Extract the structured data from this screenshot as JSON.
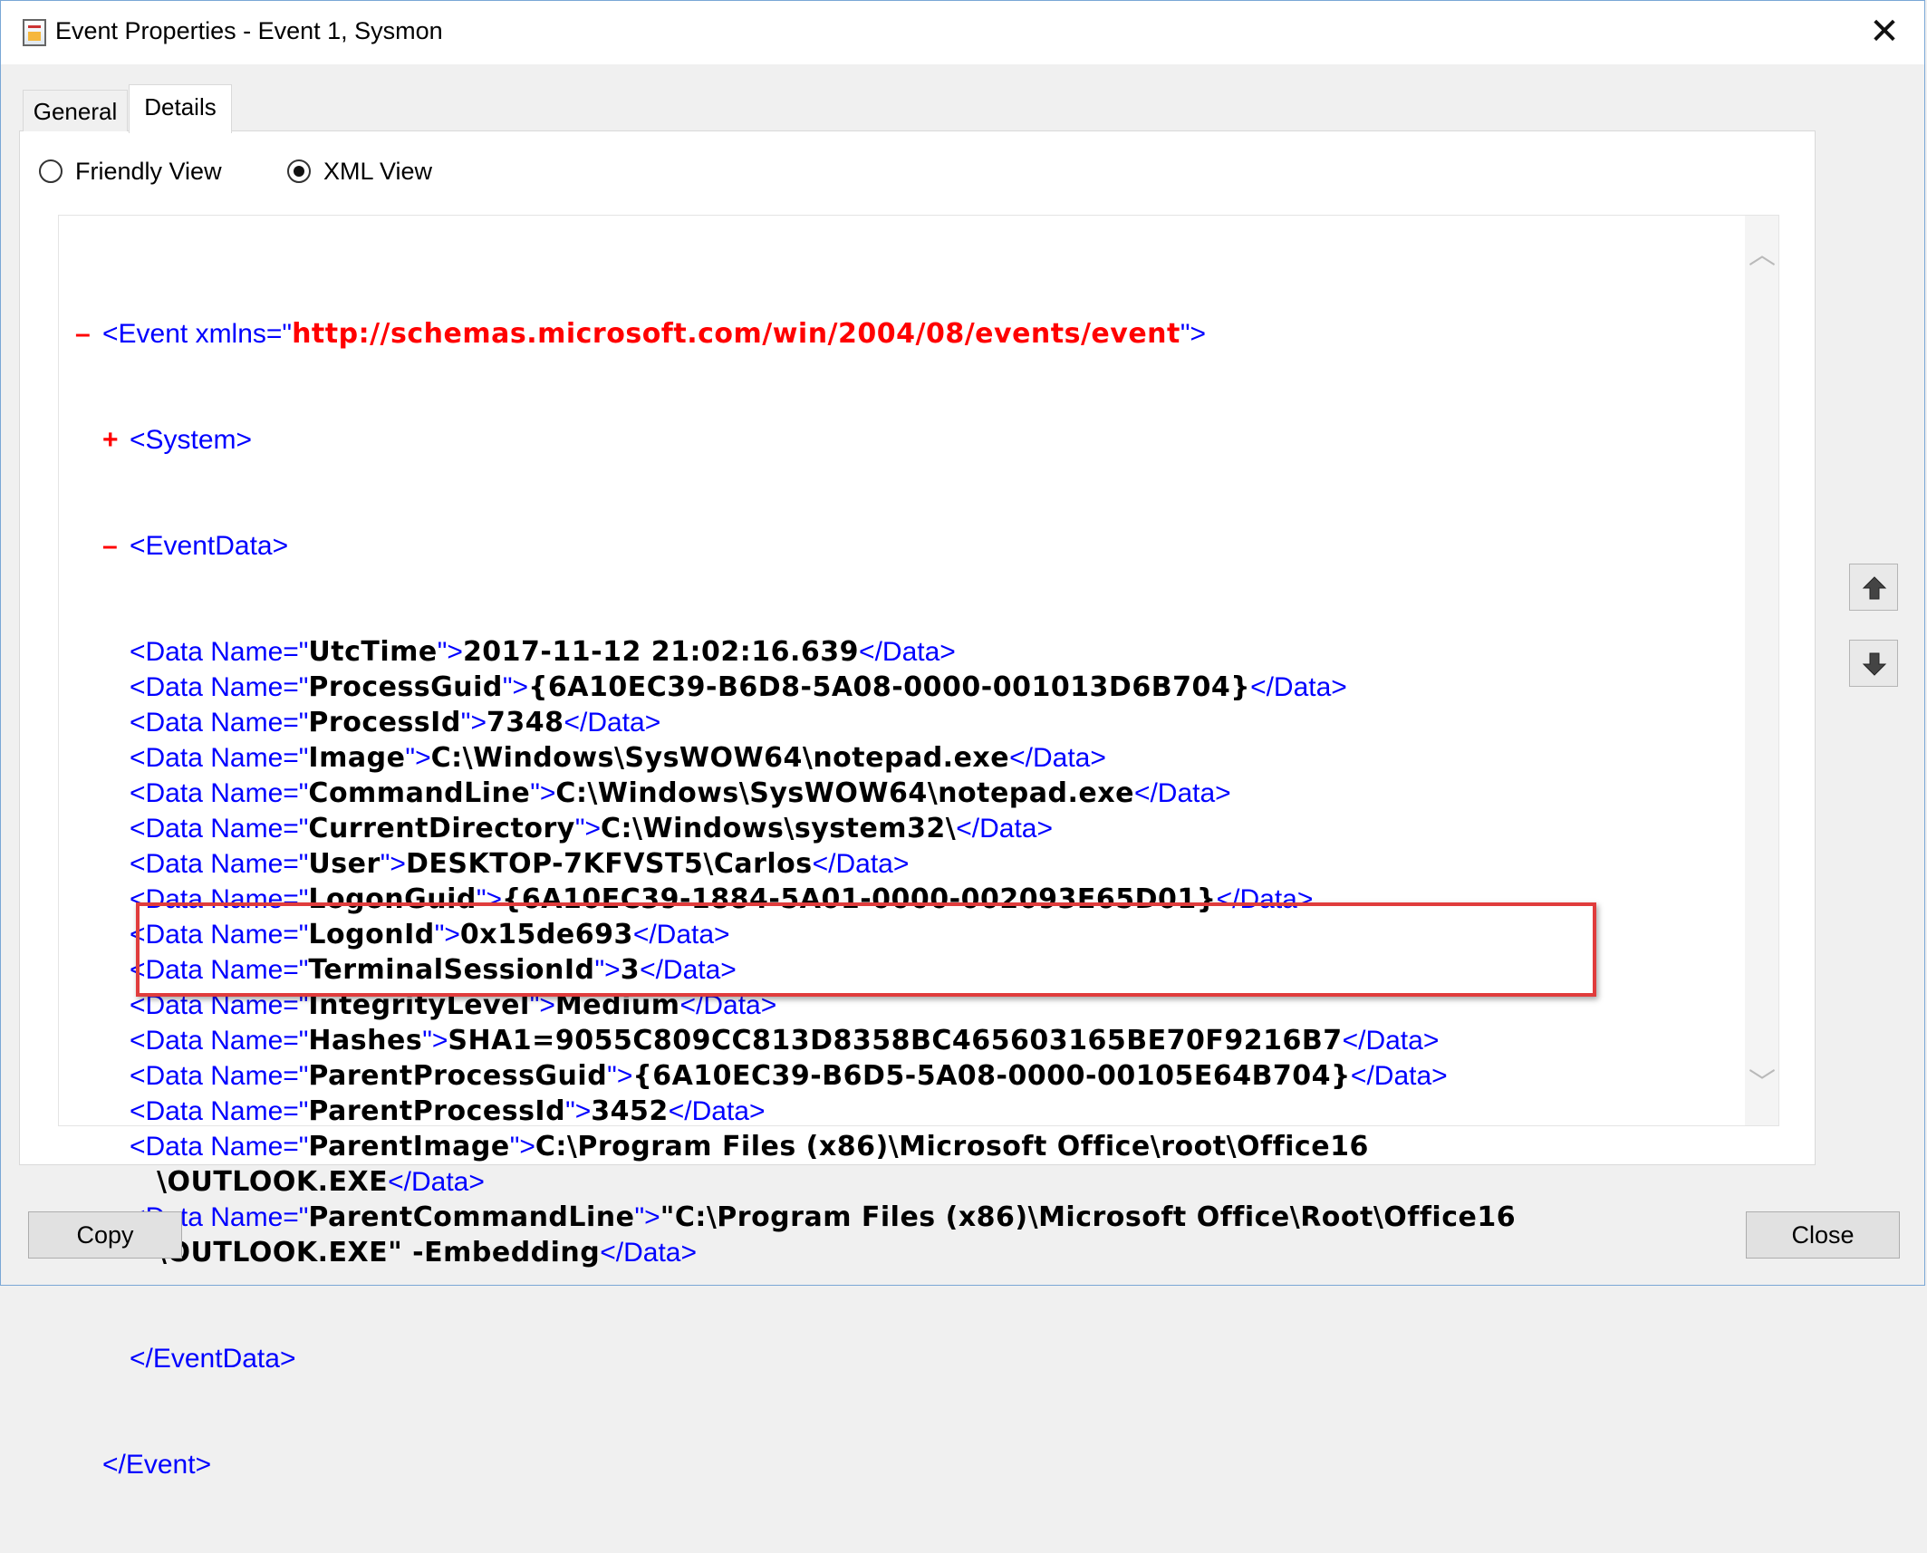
{
  "window": {
    "title": "Event Properties - Event 1, Sysmon",
    "close_glyph": "✕"
  },
  "tabs": [
    {
      "label": "General",
      "selected": false
    },
    {
      "label": "Details",
      "selected": true
    }
  ],
  "view_options": {
    "friendly_label": "Friendly View",
    "xml_label": "XML View",
    "selected": "XML View"
  },
  "xml": {
    "event_open_prefix": "<Event xmlns=\"",
    "event_ns": "http://schemas.microsoft.com/win/2004/08/events/event",
    "event_open_suffix": "\">",
    "expand_sign": "+",
    "collapse_sign": "–",
    "system_tag": "<System>",
    "eventdata_open": "<EventData>",
    "eventdata_close": "</EventData>",
    "event_close": "</Event>",
    "data_open_prefix": "<Data Name=\"",
    "data_open_suffix": "\">",
    "data_close": "</Data>",
    "data": [
      {
        "name": "UtcTime",
        "value": "2017-11-12 21:02:16.639"
      },
      {
        "name": "ProcessGuid",
        "value": "{6A10EC39-B6D8-5A08-0000-001013D6B704}"
      },
      {
        "name": "ProcessId",
        "value": "7348"
      },
      {
        "name": "Image",
        "value": "C:\\Windows\\SysWOW64\\notepad.exe"
      },
      {
        "name": "CommandLine",
        "value": "C:\\Windows\\SysWOW64\\notepad.exe"
      },
      {
        "name": "CurrentDirectory",
        "value": "C:\\Windows\\system32\\"
      },
      {
        "name": "User",
        "value": "DESKTOP-7KFVST5\\Carlos"
      },
      {
        "name": "LogonGuid",
        "value": "{6A10EC39-1884-5A01-0000-002093E65D01}"
      },
      {
        "name": "LogonId",
        "value": "0x15de693"
      },
      {
        "name": "TerminalSessionId",
        "value": "3"
      },
      {
        "name": "IntegrityLevel",
        "value": "Medium"
      },
      {
        "name": "Hashes",
        "value": "SHA1=9055C809CC813D8358BC465603165BE70F9216B7"
      },
      {
        "name": "ParentProcessGuid",
        "value": "{6A10EC39-B6D5-5A08-0000-00105E64B704}"
      },
      {
        "name": "ParentProcessId",
        "value": "3452"
      },
      {
        "name": "ParentImage",
        "value": "C:\\Program Files (x86)\\Microsoft Office\\root\\Office16",
        "value_cont": "\\OUTLOOK.EXE"
      },
      {
        "name": "ParentCommandLine",
        "value": "\"C:\\Program Files (x86)\\Microsoft Office\\Root\\Office16",
        "value_cont": "\\OUTLOOK.EXE\" -Embedding"
      }
    ]
  },
  "side_buttons": {
    "up_icon": "arrow-up-icon",
    "down_icon": "arrow-down-icon"
  },
  "buttons": {
    "copy": "Copy",
    "close": "Close"
  },
  "colors": {
    "tag": "#0000ff",
    "namespace": "#ff0000",
    "highlight": "#e03c3c"
  }
}
